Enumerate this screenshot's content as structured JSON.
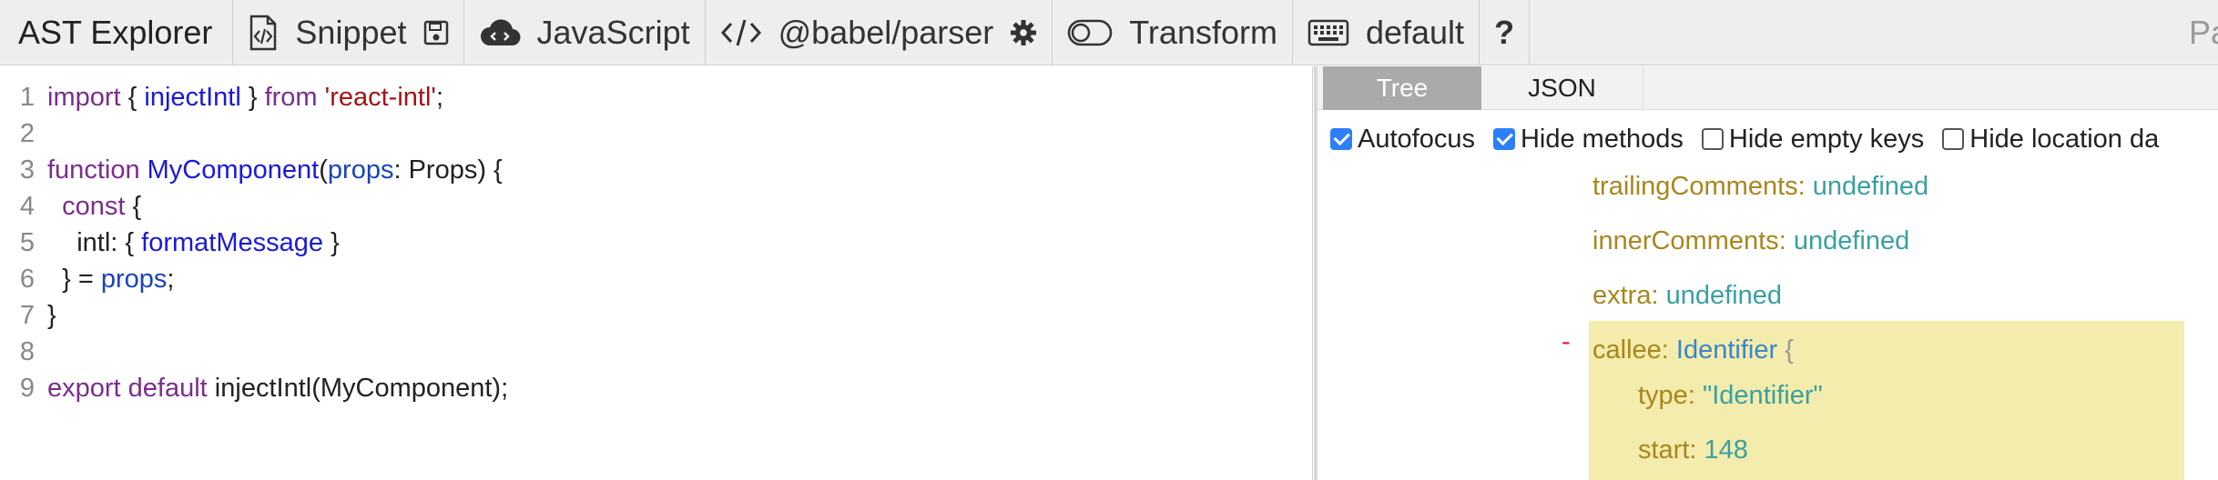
{
  "toolbar": {
    "brand": "AST Explorer",
    "snippet_label": "Snippet",
    "language_label": "JavaScript",
    "parser_label": "@babel/parser",
    "transform_label": "Transform",
    "keymap_label": "default",
    "help_label": "?",
    "right_truncated": "Pa"
  },
  "editor": {
    "lines": [
      {
        "num": "1",
        "parts": [
          [
            "kw",
            "import"
          ],
          [
            "code",
            " { "
          ],
          [
            "fn",
            "injectIntl"
          ],
          [
            "code",
            " } "
          ],
          [
            "kw",
            "from"
          ],
          [
            "code",
            " "
          ],
          [
            "str",
            "'react-intl'"
          ],
          [
            "code",
            ";"
          ]
        ]
      },
      {
        "num": "2",
        "parts": []
      },
      {
        "num": "3",
        "parts": [
          [
            "kw",
            "function"
          ],
          [
            "code",
            " "
          ],
          [
            "fn",
            "MyComponent"
          ],
          [
            "code",
            "("
          ],
          [
            "var",
            "props"
          ],
          [
            "code",
            ": Props) {"
          ]
        ]
      },
      {
        "num": "4",
        "parts": [
          [
            "code",
            "  "
          ],
          [
            "kw",
            "const"
          ],
          [
            "code",
            " {"
          ]
        ]
      },
      {
        "num": "5",
        "parts": [
          [
            "code",
            "    intl: { "
          ],
          [
            "fn",
            "formatMessage"
          ],
          [
            "code",
            " }"
          ]
        ]
      },
      {
        "num": "6",
        "parts": [
          [
            "code",
            "  } = "
          ],
          [
            "var",
            "props"
          ],
          [
            "code",
            ";"
          ]
        ]
      },
      {
        "num": "7",
        "parts": [
          [
            "code",
            "}"
          ]
        ]
      },
      {
        "num": "8",
        "parts": []
      },
      {
        "num": "9",
        "parts": [
          [
            "kw",
            "export"
          ],
          [
            "code",
            " "
          ],
          [
            "kw",
            "default"
          ],
          [
            "code",
            " injectIntl(MyComponent);"
          ]
        ]
      }
    ]
  },
  "panel": {
    "tabs": [
      {
        "label": "Tree",
        "active": true
      },
      {
        "label": "JSON",
        "active": false
      }
    ],
    "options": [
      {
        "label": "Autofocus",
        "checked": true
      },
      {
        "label": "Hide methods",
        "checked": true
      },
      {
        "label": "Hide empty keys",
        "checked": false
      },
      {
        "label": "Hide location da",
        "checked": false
      }
    ],
    "tree": {
      "trailingComments": {
        "key": "trailingComments",
        "value": "undefined"
      },
      "innerComments": {
        "key": "innerComments",
        "value": "undefined"
      },
      "extra": {
        "key": "extra",
        "value": "undefined"
      },
      "callee": {
        "key": "callee",
        "value": "Identifier",
        "brace": "{",
        "toggle": "-"
      },
      "type": {
        "key": "type",
        "value": "\"Identifier\""
      },
      "start": {
        "key": "start",
        "value": "148"
      }
    }
  },
  "colors": {
    "keyword": "#7b2d8e",
    "function": "#1a1ad6",
    "string": "#a31515",
    "tree_key": "#a9861d",
    "tree_value": "#3aa0a0",
    "highlight": "#f3ecac"
  }
}
